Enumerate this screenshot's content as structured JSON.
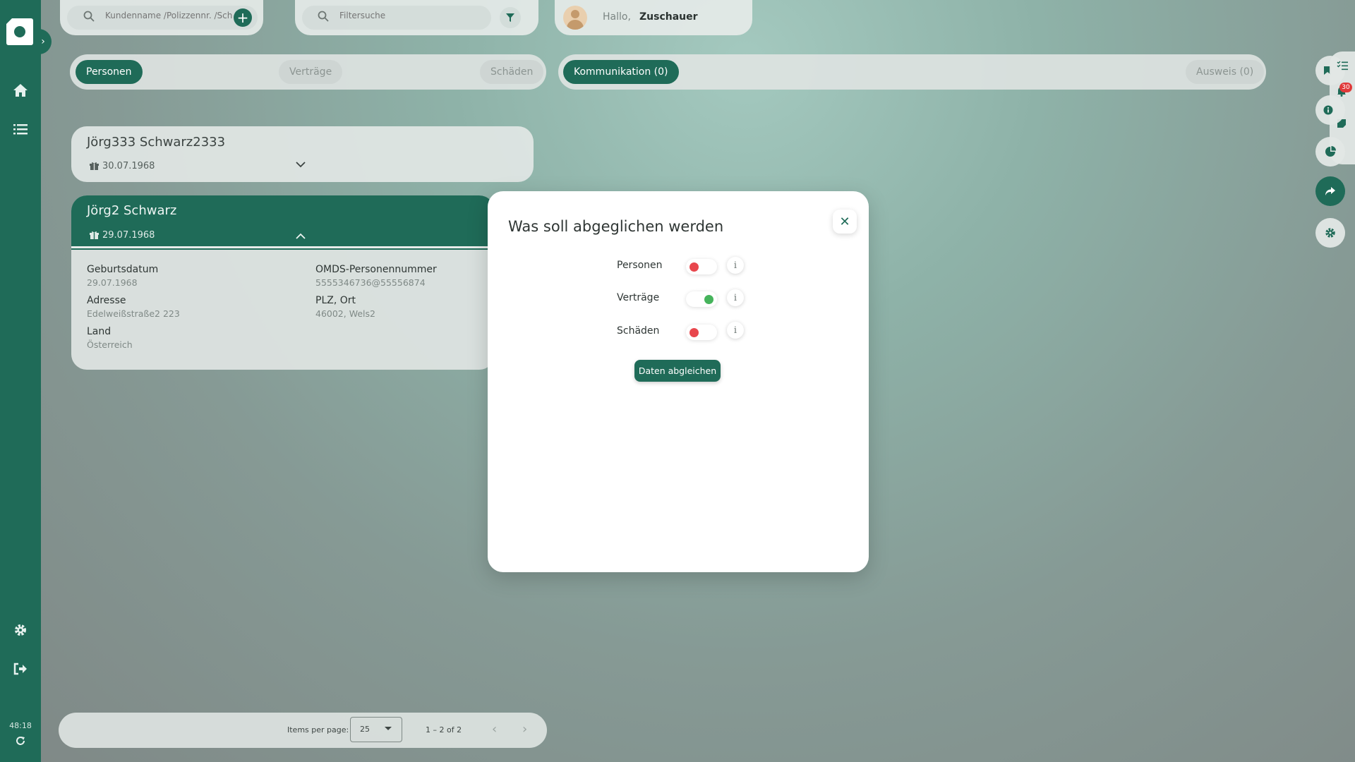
{
  "sidebar": {
    "expand_icon": "chevron-right-icon",
    "nav": [
      {
        "icon": "home-icon"
      },
      {
        "icon": "list-icon"
      }
    ],
    "bottom": [
      {
        "icon": "gear-icon"
      },
      {
        "icon": "logout-icon"
      }
    ],
    "timer": "48:18",
    "refresh_icon": "refresh-icon"
  },
  "header": {
    "customer_search_placeholder": "Kundenname /Polizzennr. /Sch",
    "filter_search_placeholder": "Filtersuche",
    "greeting": "Hallo,",
    "user_name": "Zuschauer"
  },
  "tabs_left": {
    "items": [
      {
        "label": "Personen",
        "active": true
      },
      {
        "label": "Verträge",
        "active": false
      },
      {
        "label": "Schäden",
        "active": false
      }
    ]
  },
  "tabs_right": {
    "items": [
      {
        "label": "Kommunikation (0)",
        "active": true
      },
      {
        "label": "Ausweis (0)",
        "active": false
      }
    ]
  },
  "persons": [
    {
      "name": "Jörg333 Schwarz2333",
      "dob": "30.07.1968",
      "expanded": false
    },
    {
      "name": "Jörg2 Schwarz",
      "dob": "29.07.1968",
      "expanded": true,
      "details": {
        "geburtsdatum_label": "Geburtsdatum",
        "geburtsdatum": "29.07.1968",
        "omds_label": "OMDS-Personennummer",
        "omds": "5555346736@55556874",
        "adresse_label": "Adresse",
        "adresse": "Edelweißstraße2 223",
        "plz_label": "PLZ, Ort",
        "plz": "46002, Wels2",
        "land_label": "Land",
        "land": "Österreich"
      }
    }
  ],
  "pagination": {
    "items_per_page_label": "Items per page:",
    "items_per_page": "25",
    "range": "1 – 2 of 2"
  },
  "right_rail": {
    "notification_count": "30"
  },
  "modal": {
    "title": "Was soll abgeglichen werden",
    "options": [
      {
        "label": "Personen",
        "enabled": false
      },
      {
        "label": "Verträge",
        "enabled": true
      },
      {
        "label": "Schäden",
        "enabled": false
      }
    ],
    "info_glyph": "i",
    "submit_label": "Daten abgleichen",
    "colors": {
      "off": "#e8474d",
      "on": "#45b35b",
      "accent": "#1f6b58"
    }
  }
}
